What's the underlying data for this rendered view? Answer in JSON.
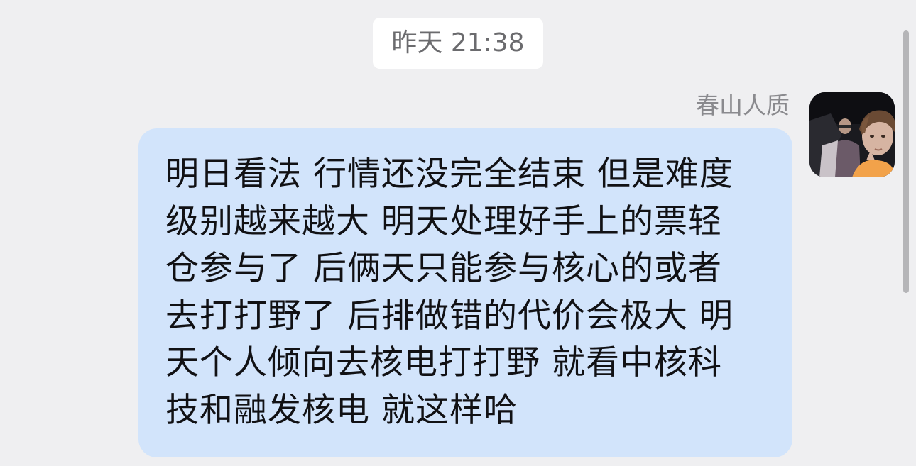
{
  "chat": {
    "timestamp": "昨天 21:38",
    "messages": [
      {
        "sender_name": "春山人质",
        "avatar_icon": "user-avatar-photo",
        "text": "明日看法 行情还没完全结束 但是难度\n级别越来越大 明天处理好手上的票轻\n仓参与了 后俩天只能参与核心的或者\n去打打野了 后排做错的代价会极大 明\n天个人倾向去核电打打野 就看中核科\n技和融发核电 就这样哈",
        "bubble_color": "#d2e4fb"
      }
    ]
  },
  "colors": {
    "background": "#efeff1",
    "timestamp_bg": "#ffffff",
    "scrollbar": "#b5b5b8"
  }
}
